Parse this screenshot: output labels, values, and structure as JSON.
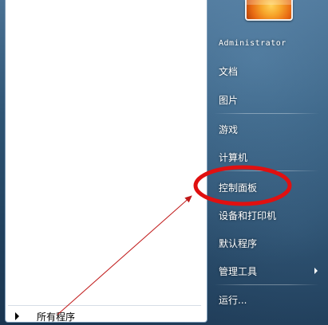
{
  "left_panel": {
    "all_programs_label": "所有程序"
  },
  "user": {
    "name": "Administrator",
    "avatar_icon": "flower-avatar"
  },
  "right_menu": {
    "documents": "文档",
    "pictures": "图片",
    "games": "游戏",
    "computer": "计算机",
    "control_panel": "控制面板",
    "devices_printers": "设备和打印机",
    "default_programs": "默认程序",
    "admin_tools": "管理工具",
    "run": "运行..."
  },
  "annotation": {
    "highlight_color": "#e01010",
    "arrow_color": "#c01818"
  }
}
